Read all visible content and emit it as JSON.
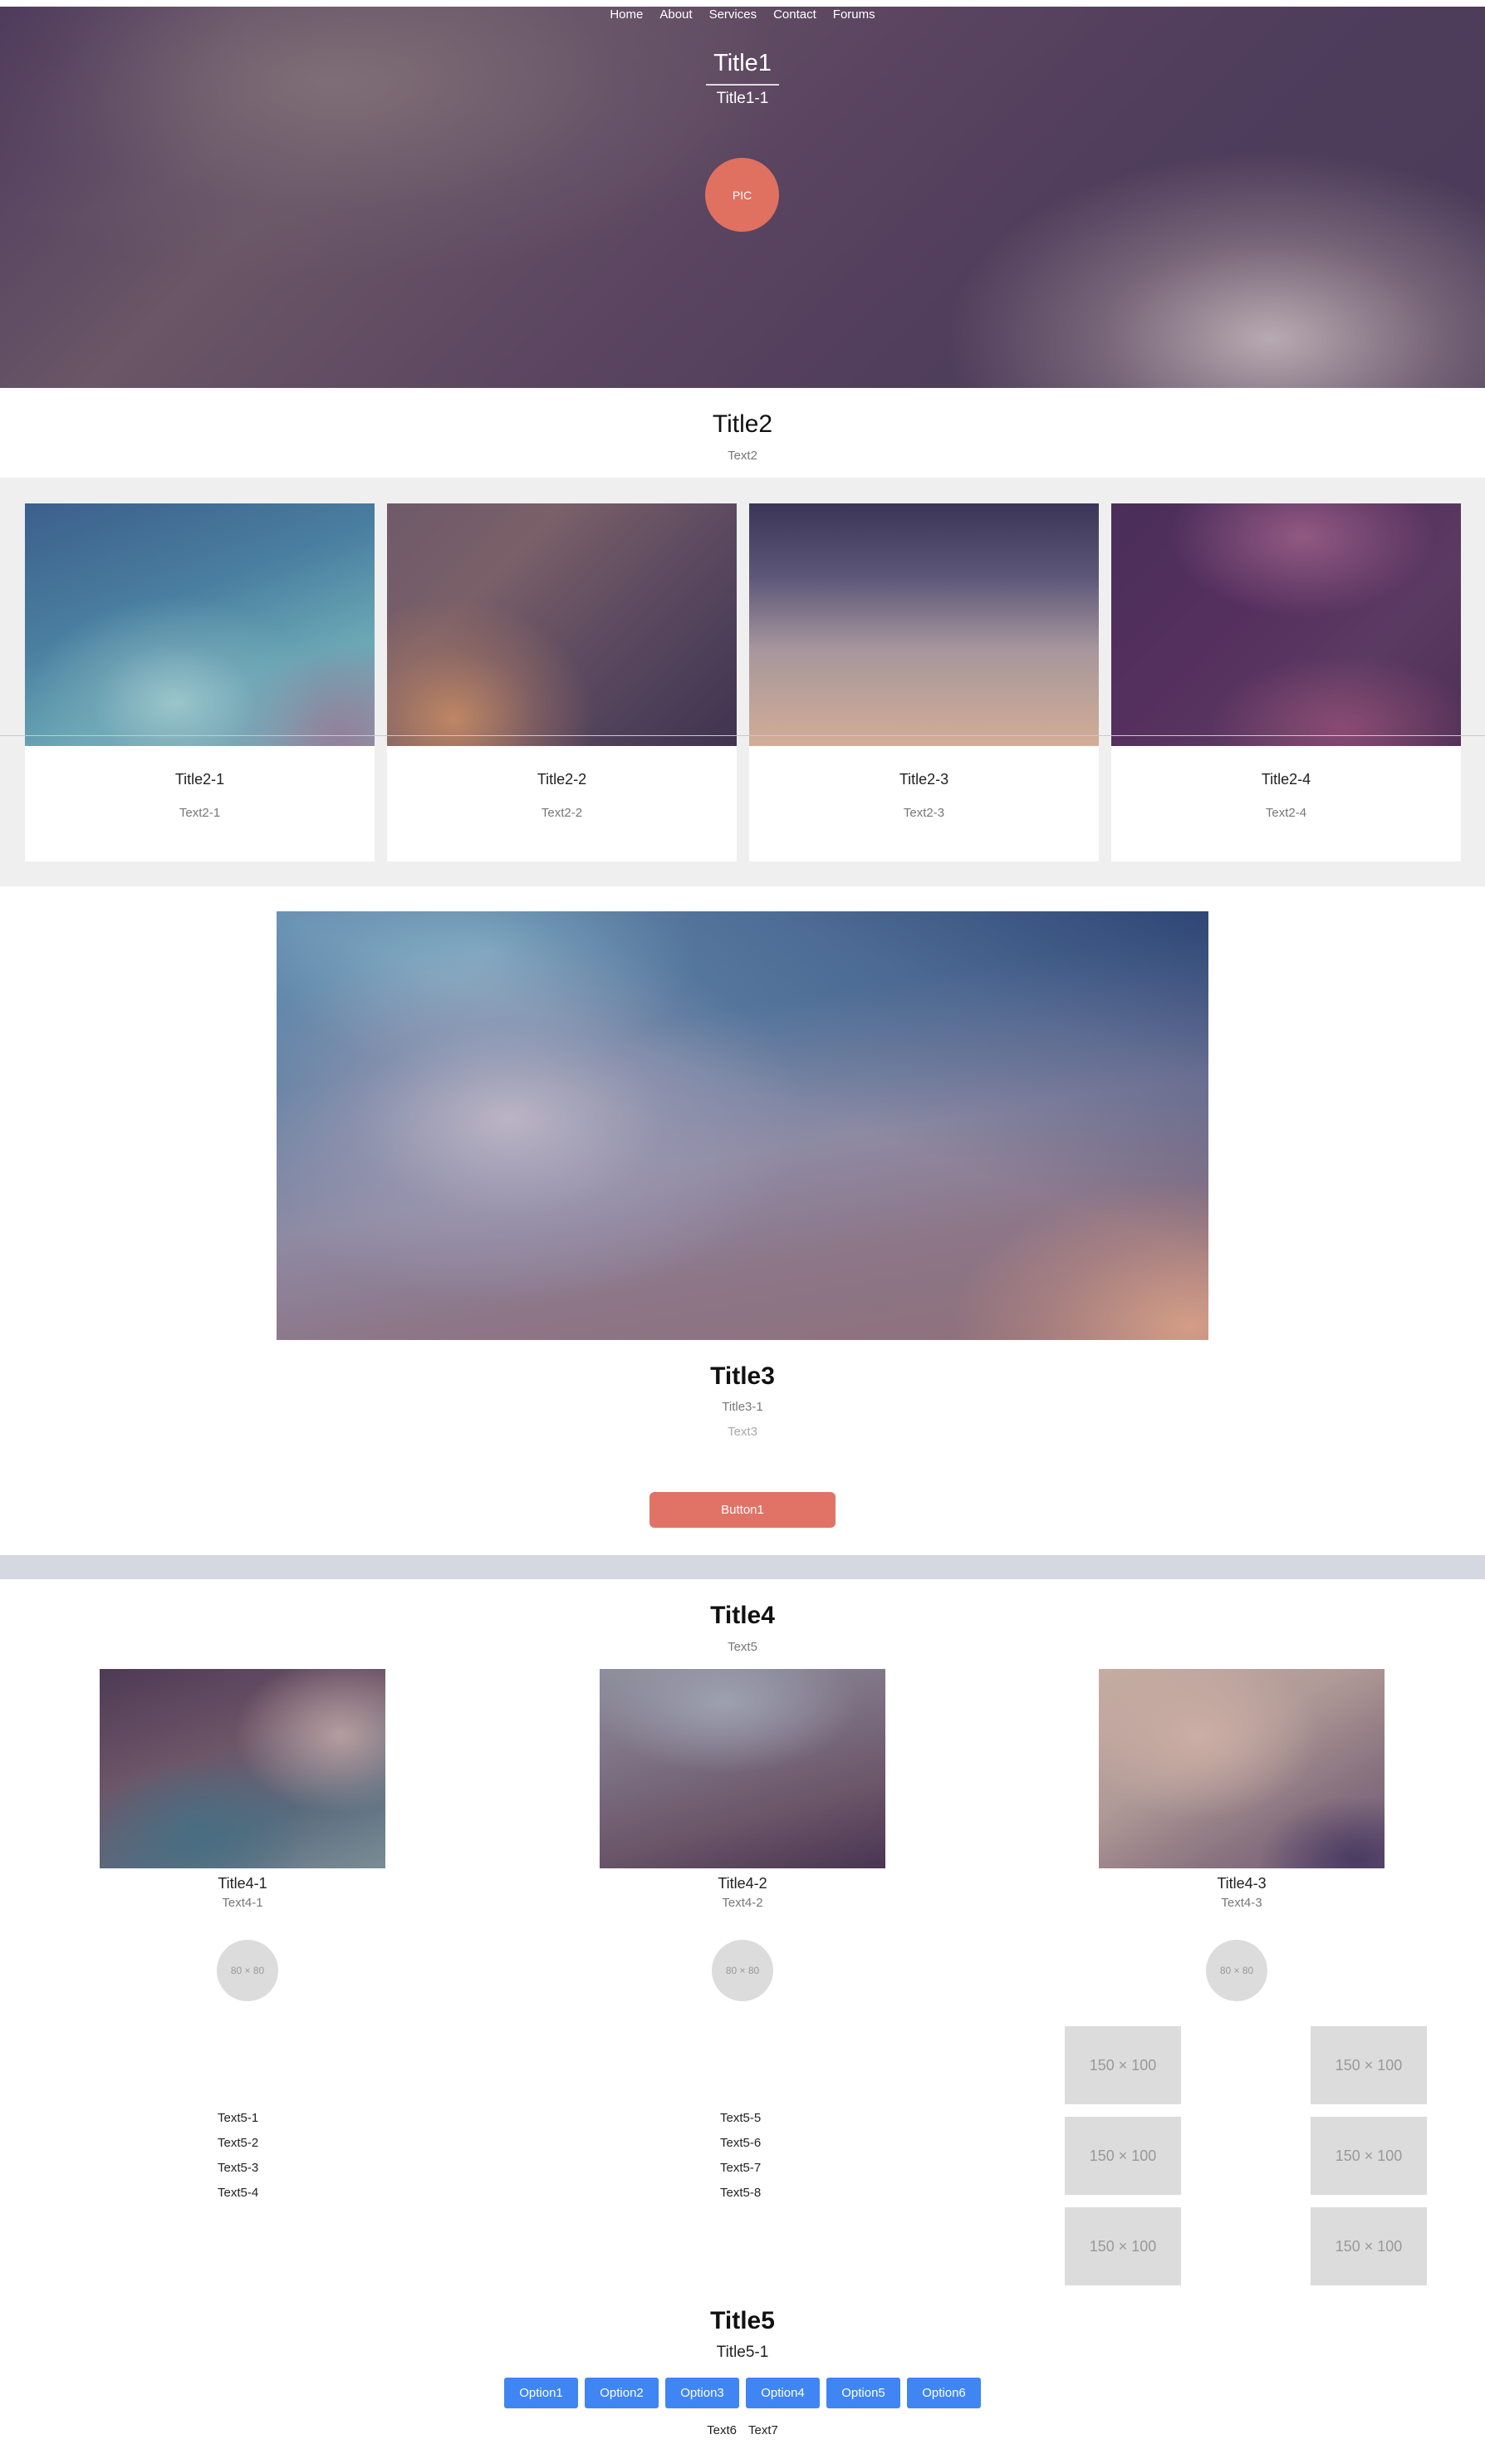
{
  "nav": {
    "items": [
      "Home",
      "About",
      "Services",
      "Contact",
      "Forums"
    ]
  },
  "hero": {
    "title": "Title1",
    "subtitle": "Title1-1",
    "pic_label": "PIC"
  },
  "section2": {
    "title": "Title2",
    "text": "Text2",
    "cards": [
      {
        "title": "Title2-1",
        "text": "Text2-1"
      },
      {
        "title": "Title2-2",
        "text": "Text2-2"
      },
      {
        "title": "Title2-3",
        "text": "Text2-3"
      },
      {
        "title": "Title2-4",
        "text": "Text2-4"
      }
    ]
  },
  "section3": {
    "title": "Title3",
    "subtitle": "Title3-1",
    "text": "Text3",
    "button_label": "Button1"
  },
  "section4": {
    "title": "Title4",
    "text": "Text5",
    "columns": [
      {
        "title": "Title4-1",
        "text": "Text4-1",
        "avatar_label": "80 × 80"
      },
      {
        "title": "Title4-2",
        "text": "Text4-2",
        "avatar_label": "80 × 80"
      },
      {
        "title": "Title4-3",
        "text": "Text4-3",
        "avatar_label": "80 × 80"
      }
    ],
    "list_left": [
      "Text5-1",
      "Text5-2",
      "Text5-3",
      "Text5-4"
    ],
    "list_right": [
      "Text5-5",
      "Text5-6",
      "Text5-7",
      "Text5-8"
    ],
    "thumbs": [
      "150 × 100",
      "150 × 100",
      "150 × 100",
      "150 × 100",
      "150 × 100",
      "150 × 100"
    ]
  },
  "section5": {
    "title": "Title5",
    "subtitle": "Title5-1",
    "options": [
      "Option1",
      "Option2",
      "Option3",
      "Option4",
      "Option5",
      "Option6"
    ],
    "footer_links": [
      "Text6",
      "Text7"
    ]
  },
  "colors": {
    "accent": "#e07366",
    "option_blue": "#3f85f4",
    "divider": "#d5d8e0",
    "band": "#efefef"
  }
}
